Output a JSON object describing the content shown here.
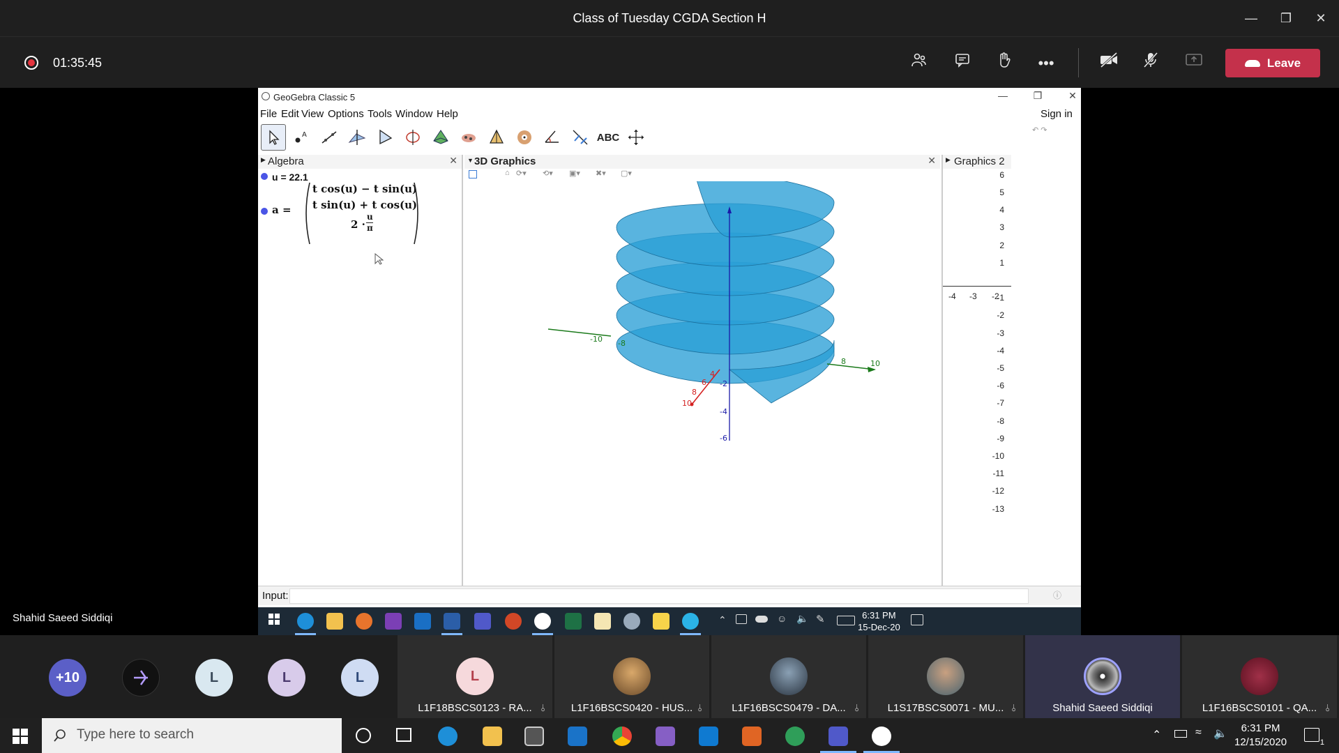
{
  "meeting": {
    "title": "Class of Tuesday CGDA Section H",
    "record_time": "01:35:45",
    "leave_label": "Leave",
    "presenter_name": "Shahid Saeed Siddiqi"
  },
  "geogebra": {
    "window_title": "GeoGebra Classic 5",
    "menu": [
      "File",
      "Edit",
      "View",
      "Options",
      "Tools",
      "Window",
      "Help"
    ],
    "sign_in": "Sign in",
    "abc_tool": "ABC",
    "panels": {
      "algebra": "Algebra",
      "graphics3d": "3D Graphics",
      "graphics2": "Graphics 2"
    },
    "algebra": {
      "u_def": "u = 22.1",
      "a_label": "a =",
      "row1": "t cos(u) − t sin(u)",
      "row2": "t sin(u) + t cos(u)",
      "row3_prefix": "2 ·",
      "row3_num": "u",
      "row3_den": "π"
    },
    "graphics2_y_ticks": [
      "6",
      "5",
      "4",
      "3",
      "2",
      "1",
      "-1",
      "-2",
      "-3",
      "-4",
      "-5",
      "-6",
      "-7",
      "-8",
      "-9",
      "-10",
      "-11",
      "-12",
      "-13"
    ],
    "graphics2_x_ticks": [
      "-4",
      "-3",
      "-2"
    ],
    "axis3d": {
      "x_neg": [
        "-10",
        "-8"
      ],
      "x_pos": [
        "8",
        "10"
      ],
      "z_neg": [
        "-2",
        "-4",
        "-6"
      ],
      "red": [
        "10",
        "8",
        "6",
        "4"
      ]
    },
    "input_label": "Input:",
    "colors": {
      "surface": "#2a9fd6",
      "axis_green": "#1b7a1b",
      "axis_red": "#d42020",
      "axis_blue": "#1a1aa8"
    }
  },
  "inner_taskbar": {
    "time": "6:31 PM",
    "date": "15-Dec-20"
  },
  "participants": {
    "overflow": "+10",
    "initial_avatars": [
      "L",
      "L",
      "L"
    ],
    "tiles": [
      {
        "name": "L1F18BSCS0123 - RA...",
        "initial": "L"
      },
      {
        "name": "L1F16BSCS0420 - HUS..."
      },
      {
        "name": "L1F16BSCS0479 - DA..."
      },
      {
        "name": "L1S17BSCS0071 - MU..."
      },
      {
        "name": "Shahid Saeed Siddiqi"
      },
      {
        "name": "L1F16BSCS0101 - QA..."
      }
    ]
  },
  "host_taskbar": {
    "search_placeholder": "Type here to search",
    "time": "6:31 PM",
    "date": "12/15/2020",
    "notifications": "1"
  }
}
